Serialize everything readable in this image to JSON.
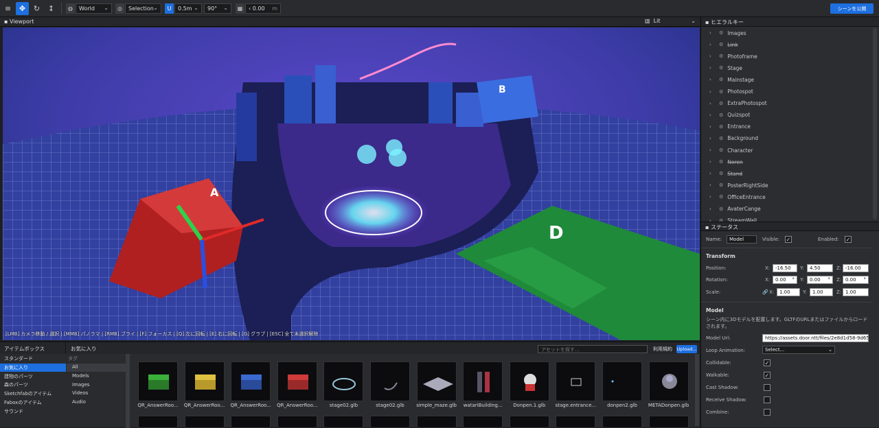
{
  "toolbar": {
    "space": "World",
    "snap_mode": "Selection",
    "snap_move": "0.5m",
    "snap_rotate": "90°",
    "grid_value": "0.00",
    "grid_unit": "m",
    "publish_label": "シーンを公開"
  },
  "viewport": {
    "title": "Viewport",
    "render_mode": "Lit",
    "hint": "[LMB] カメラ移動 / 選択 | [MMB] パノラマ | [RMB] ブライ | [F] フォーカス | [Q] 左に回転 | [E] 右に回転 | [G] グラブ | [ESC] 全て未選択解除",
    "box_a_label": "A",
    "box_b_label": "B",
    "box_d_label": "D"
  },
  "hierarchy": {
    "title": "ヒエラルキー",
    "items": [
      {
        "label": "Images",
        "strike": false
      },
      {
        "label": "Link",
        "strike": true
      },
      {
        "label": "Photoframe",
        "strike": false
      },
      {
        "label": "Stage",
        "strike": false
      },
      {
        "label": "Mainstage",
        "strike": false
      },
      {
        "label": "Photospot",
        "strike": false
      },
      {
        "label": "ExtraPhotospot",
        "strike": false
      },
      {
        "label": "Quizspot",
        "strike": false
      },
      {
        "label": "Entrance",
        "strike": false
      },
      {
        "label": "Background",
        "strike": false
      },
      {
        "label": "Character",
        "strike": false
      },
      {
        "label": "Noren",
        "strike": true
      },
      {
        "label": "Stand",
        "strike": true
      },
      {
        "label": "PosterRightSide",
        "strike": false
      },
      {
        "label": "OfficeEntrance",
        "strike": false
      },
      {
        "label": "AvaterCange",
        "strike": false
      },
      {
        "label": "StreamWall",
        "strike": false
      }
    ]
  },
  "status": {
    "title": "ステータス",
    "name_label": "Name:",
    "name_value": "Model",
    "visible_label": "Visible:",
    "enabled_label": "Enabled:",
    "transform_title": "Transform",
    "position_label": "Position:",
    "rotation_label": "Rotation:",
    "scale_label": "Scale:",
    "axis_x": "X:",
    "axis_y": "Y:",
    "axis_z": "Z:",
    "position": {
      "x": "-16.50",
      "y": "4.50",
      "z": "-16.00"
    },
    "rotation": {
      "x": "0.00",
      "y": "0.00",
      "z": "0.00"
    },
    "scale": {
      "x": "1.00",
      "y": "1.00",
      "z": "1.00"
    },
    "degree": "°",
    "model_title": "Model",
    "model_desc": "シーン内に3Dモデルを配置します。GLTFのURLまたはファイルからロードされます。",
    "model_url_label": "Model Url:",
    "model_url_value": "https://assets.door.ntt/files/2e8d1d58-9d65-49f",
    "loop_label": "Loop Animation:",
    "loop_value": "Select...",
    "collidable_label": "Collidable:",
    "walkable_label": "Walkable:",
    "cast_label": "Cast Shadow:",
    "receive_label": "Receive Shadow:",
    "combine_label": "Combine:"
  },
  "itembox": {
    "title": "アイテムボックス",
    "categories": [
      "スタンダード",
      "お気に入り",
      "建物のパーツ",
      "森のパーツ",
      "Sketchfabのアイテム",
      "Faboxのアイテム",
      "サウンド"
    ],
    "selected_index": 1,
    "fav_title": "お気に入り",
    "tag_label": "タグ",
    "tags": [
      "All",
      "Models",
      "Images",
      "Videos",
      "Audio"
    ],
    "search_placeholder": "アセットを探す...",
    "sort_label": "利用規約",
    "upload_label": "Upload..."
  },
  "assets": [
    {
      "name": "QR_AnswerRoo...",
      "thumb": "green-room"
    },
    {
      "name": "QR_AnswerRoo...",
      "thumb": "yellow-room"
    },
    {
      "name": "QR_AnswerRoo...",
      "thumb": "blue-room"
    },
    {
      "name": "QR_AnswerRoo...",
      "thumb": "red-room"
    },
    {
      "name": "stage02.glb",
      "thumb": "stage"
    },
    {
      "name": "stage02.glb",
      "thumb": "arc"
    },
    {
      "name": "simple_maze.glb",
      "thumb": "maze"
    },
    {
      "name": "watariBuilding...",
      "thumb": "building"
    },
    {
      "name": "Donpen.1.glb",
      "thumb": "donpen"
    },
    {
      "name": "stage.entrance...",
      "thumb": "entrance"
    },
    {
      "name": "donpen2.glb",
      "thumb": "dot"
    },
    {
      "name": "METADonpen.glb",
      "thumb": "meta-donpen"
    }
  ],
  "colors": {
    "accent": "#1e6fe0",
    "panel": "#2b2d31",
    "toolbar": "#2a2b2e"
  }
}
